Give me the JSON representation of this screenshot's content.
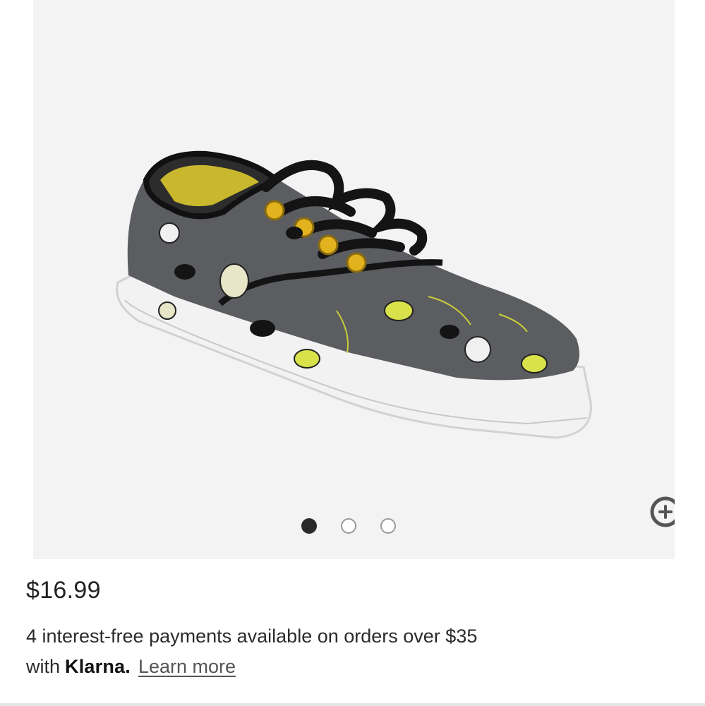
{
  "product": {
    "image_alt": "Gray canvas lace-up sneaker with black laces and yellow cartoon print",
    "price": "$16.99"
  },
  "gallery": {
    "total_images": 3,
    "active_index": 0,
    "next_icon": "chevron-right-icon",
    "zoom_icon": "zoom-in-icon"
  },
  "klarna": {
    "line1": "4 interest-free payments available on orders over $35",
    "with_text": "with",
    "logo_text": "Klarna.",
    "learn_more": "Learn more"
  },
  "colors": {
    "gallery_bg": "#f3f3f3",
    "shoe_upper": "#5b5d60",
    "accent_yellow": "#d9e24a",
    "lace_black": "#141414",
    "sole_white": "#f2f2f2"
  }
}
